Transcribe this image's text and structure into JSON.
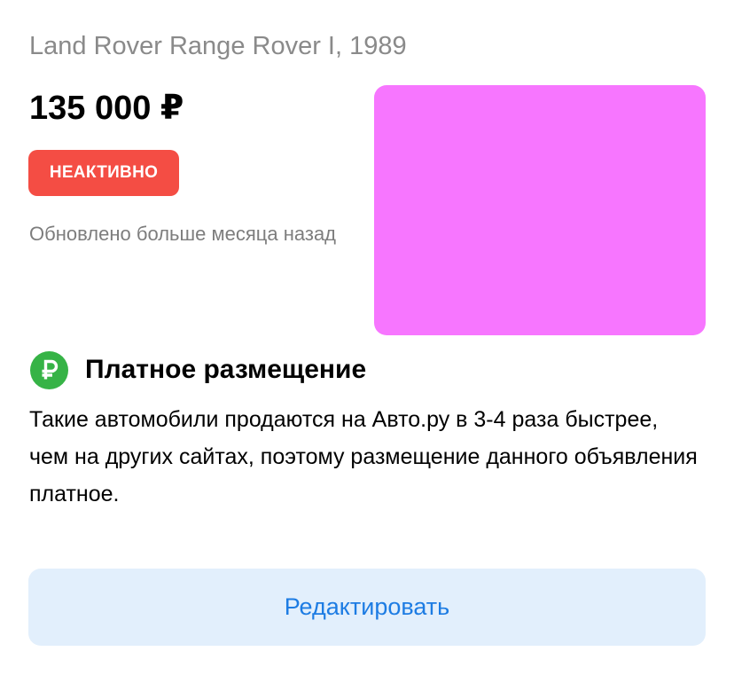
{
  "listing": {
    "title": "Land Rover Range Rover I, 1989",
    "price": "135 000 ₽",
    "status_badge": "НЕАКТИВНО",
    "updated": "Обновлено больше месяца назад",
    "photo_placeholder_color": "#f776ff"
  },
  "paid_placement": {
    "icon": "ruble-icon",
    "heading": "Платное размещение",
    "description": "Такие автомобили продаются на Авто.ру в 3-4 раза быстрее, чем на других сайтах, поэтому размещение данного объявления платное."
  },
  "actions": {
    "edit_label": "Редактировать"
  },
  "colors": {
    "badge_red": "#f44d44",
    "icon_green": "#36b346",
    "button_bg": "#e2effc",
    "button_text": "#1d7ce3"
  }
}
